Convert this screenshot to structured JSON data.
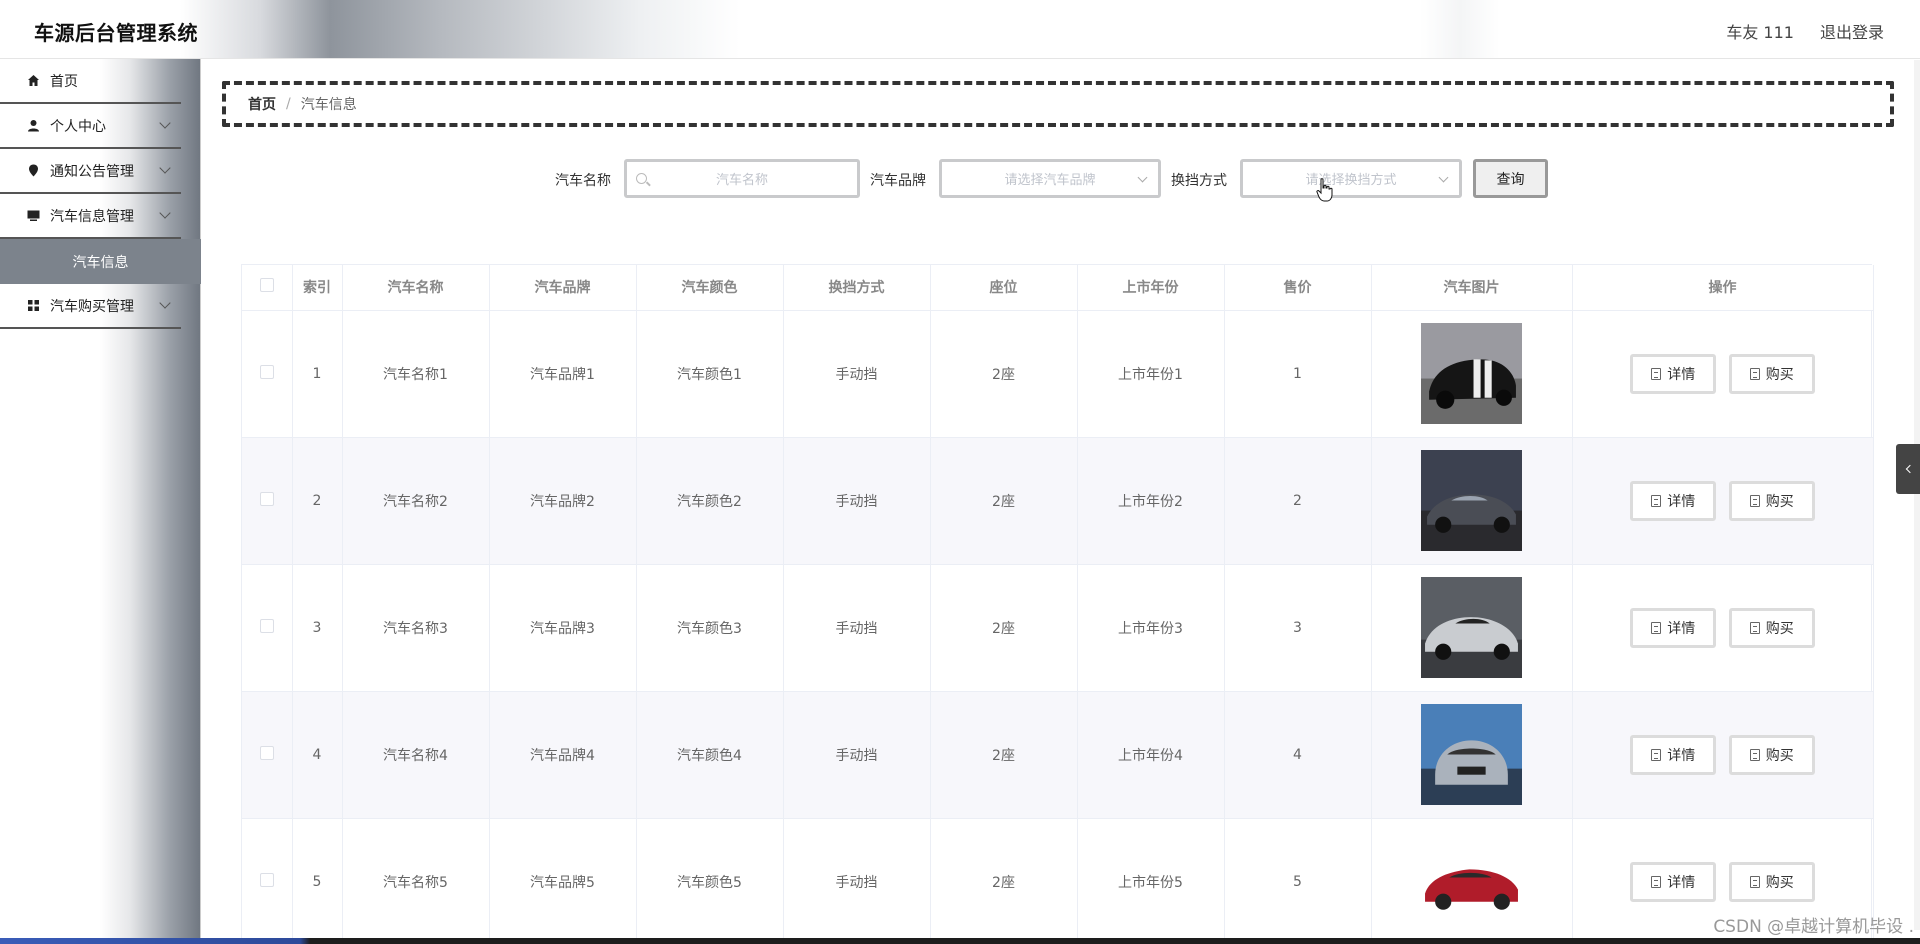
{
  "app": {
    "title": "车源后台管理系统",
    "user": "车友 111",
    "logout": "退出登录"
  },
  "sidebar": {
    "items": [
      {
        "label": "首页",
        "icon": "home-icon"
      },
      {
        "label": "个人中心",
        "icon": "user-icon"
      },
      {
        "label": "通知公告管理",
        "icon": "pin-icon"
      },
      {
        "label": "汽车信息管理",
        "icon": "monitor-icon"
      },
      {
        "label": "汽车购买管理",
        "icon": "grid-icon"
      }
    ],
    "active_sub": "汽车信息"
  },
  "breadcrumb": {
    "home": "首页",
    "separator": "/",
    "current": "汽车信息"
  },
  "search": {
    "name_label": "汽车名称",
    "name_placeholder": "汽车名称",
    "brand_label": "汽车品牌",
    "brand_placeholder": "请选择汽车品牌",
    "gear_label": "换挡方式",
    "gear_placeholder": "请选择换挡方式",
    "query_button": "查询"
  },
  "table": {
    "headers": [
      "索引",
      "汽车名称",
      "汽车品牌",
      "汽车颜色",
      "换挡方式",
      "座位",
      "上市年份",
      "售价",
      "汽车图片",
      "操作"
    ],
    "detail_label": "详情",
    "buy_label": "购买",
    "rows": [
      {
        "index": "1",
        "name": "汽车名称1",
        "brand": "汽车品牌1",
        "color": "汽车颜色1",
        "gear": "手动挡",
        "seats": "2座",
        "year": "上市年份1",
        "price": "1",
        "image": "black-muscle-car"
      },
      {
        "index": "2",
        "name": "汽车名称2",
        "brand": "汽车品牌2",
        "color": "汽车颜色2",
        "gear": "手动挡",
        "seats": "2座",
        "year": "上市年份2",
        "price": "2",
        "image": "dark-roadster"
      },
      {
        "index": "3",
        "name": "汽车名称3",
        "brand": "汽车品牌3",
        "color": "汽车颜色3",
        "gear": "手动挡",
        "seats": "2座",
        "year": "上市年份3",
        "price": "3",
        "image": "silver-supercar"
      },
      {
        "index": "4",
        "name": "汽车名称4",
        "brand": "汽车品牌4",
        "color": "汽车颜色4",
        "gear": "手动挡",
        "seats": "2座",
        "year": "上市年份4",
        "price": "4",
        "image": "silver-sedan"
      },
      {
        "index": "5",
        "name": "汽车名称5",
        "brand": "汽车品牌5",
        "color": "汽车颜色5",
        "gear": "手动挡",
        "seats": "2座",
        "year": "上市年份5",
        "price": "5",
        "image": "red-sedan"
      }
    ]
  },
  "watermark": "CSDN @卓越计算机毕设 ."
}
